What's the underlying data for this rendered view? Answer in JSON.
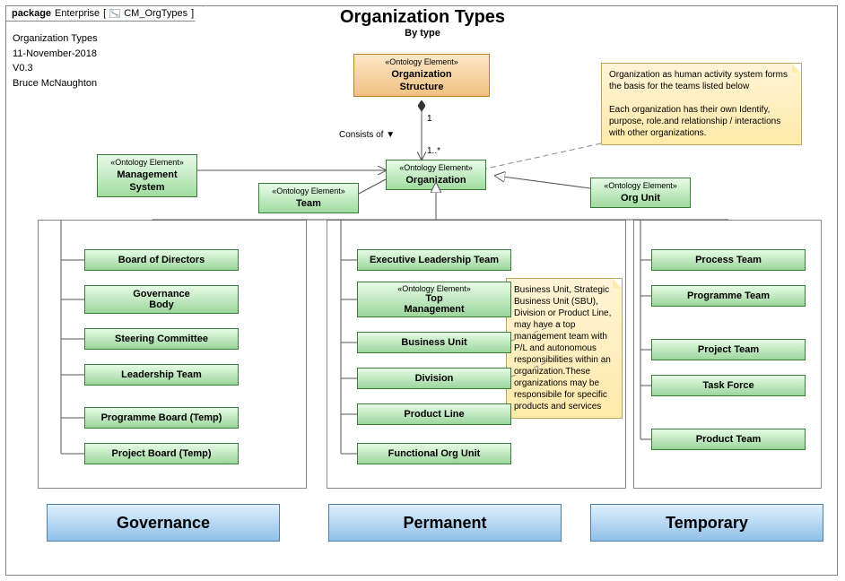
{
  "package": {
    "label": "package",
    "context": "Enterprise",
    "name": "CM_OrgTypes"
  },
  "meta": {
    "title_full": "Organization Types",
    "date": "11-November-2018",
    "version": "V0.3",
    "author": "Bruce McNaughton"
  },
  "title": {
    "main": "Organization Types",
    "sub": "By type"
  },
  "stereotype": "«Ontology Element»",
  "elements": {
    "org_structure": "Organization\nStructure",
    "management_system": "Management\nSystem",
    "team": "Team",
    "organization": "Organization",
    "org_unit": "Org Unit"
  },
  "relations": {
    "consists_of": "Consists of",
    "one": "1",
    "one_many": "1..*"
  },
  "notes": {
    "top": "Organization as human activity system forms the basis for the teams listed below\n\nEach organization has their own Identify, purpose, role.and relationship / interactions with other organizations.",
    "mid": "Business Unit, Strategic Business Unit (SBU), Division or Product Line, may have a top management team with P/L and autonomous responsibilities within an organization.These organizations may be responsibile for specific products and services"
  },
  "governance": [
    "Board of Directors",
    "Governance\nBody",
    "Steering Committee",
    "Leadership Team",
    "Programme Board (Temp)",
    "Project Board (Temp)"
  ],
  "permanent": [
    {
      "label": "Executive Leadership Team"
    },
    {
      "stereo": true,
      "label": "Top\nManagement"
    },
    {
      "label": "Business Unit"
    },
    {
      "label": "Division"
    },
    {
      "label": "Product Line"
    },
    {
      "label": "Functional Org Unit"
    }
  ],
  "temporary": [
    "Process Team",
    "Programme Team",
    "Project Team",
    "Task Force",
    "Product Team"
  ],
  "categories": {
    "gov": "Governance",
    "perm": "Permanent",
    "temp": "Temporary"
  }
}
